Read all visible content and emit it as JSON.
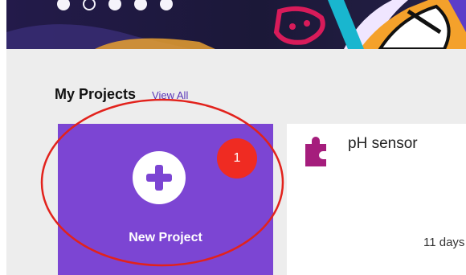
{
  "banner": {
    "dots": [
      "filled",
      "hollow",
      "filled",
      "filled",
      "filled"
    ]
  },
  "projects_section": {
    "title": "My Projects",
    "view_all_label": "View All"
  },
  "new_project_card": {
    "label": "New Project",
    "icon": "plus-icon"
  },
  "annotation": {
    "badge_number": "1",
    "highlight_color": "#e2221c"
  },
  "project_cards": [
    {
      "name": "pH sensor",
      "icon": "puzzle-piece-icon",
      "updated": "11 days"
    }
  ],
  "colors": {
    "accent_purple": "#7c45d3",
    "link_purple": "#5a36b8",
    "puzzle_magenta": "#a51d7c",
    "background": "#ededed"
  }
}
